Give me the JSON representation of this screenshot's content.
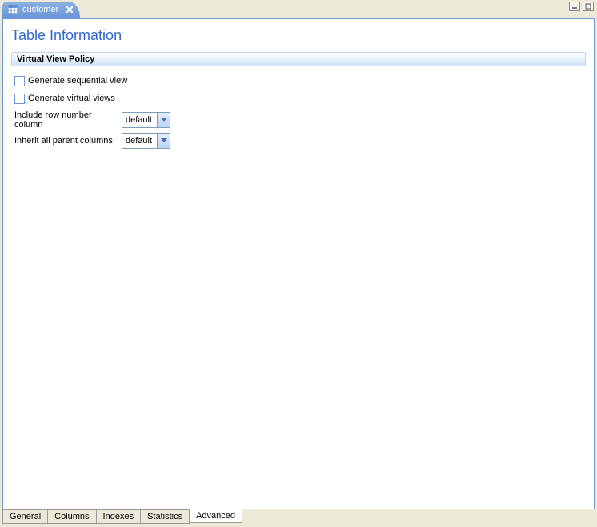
{
  "top_tab": {
    "label": "customer"
  },
  "page_title": "Table Information",
  "section": {
    "title": "Virtual View Policy",
    "checkboxes": [
      {
        "label": "Generate sequential view",
        "checked": false
      },
      {
        "label": "Generate virtual views",
        "checked": false
      }
    ],
    "selects": [
      {
        "label": "Include row number column",
        "value": "default"
      },
      {
        "label": "Inherit all parent columns",
        "value": "default"
      }
    ]
  },
  "bottom_tabs": [
    {
      "label": "General",
      "active": false
    },
    {
      "label": "Columns",
      "active": false
    },
    {
      "label": "Indexes",
      "active": false
    },
    {
      "label": "Statistics",
      "active": false
    },
    {
      "label": "Advanced",
      "active": true
    }
  ]
}
